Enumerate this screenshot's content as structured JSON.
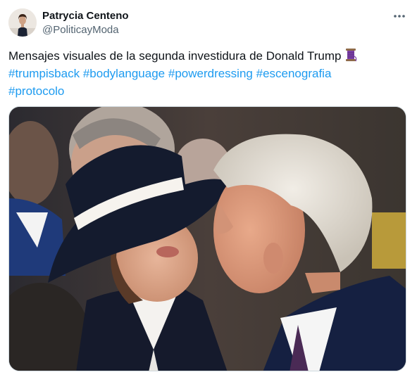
{
  "author": {
    "display_name": "Patrycia Centeno",
    "handle": "@PoliticayModa"
  },
  "tweet": {
    "text": "Mensajes visuales de la segunda investidura de Donald Trump",
    "emoji_icon": "thread-spool-icon",
    "hashtags": [
      "#trumpisback",
      "#bodylanguage",
      "#powerdressing",
      "#escenografia",
      "#protocolo"
    ]
  },
  "media": {
    "type": "photo",
    "icon": "photo"
  },
  "colors": {
    "link": "#1d9bf0",
    "text": "#0f1419",
    "secondary": "#536471",
    "border": "#cfd9de"
  },
  "actions": {
    "more_icon": "more-horizontal-icon"
  }
}
